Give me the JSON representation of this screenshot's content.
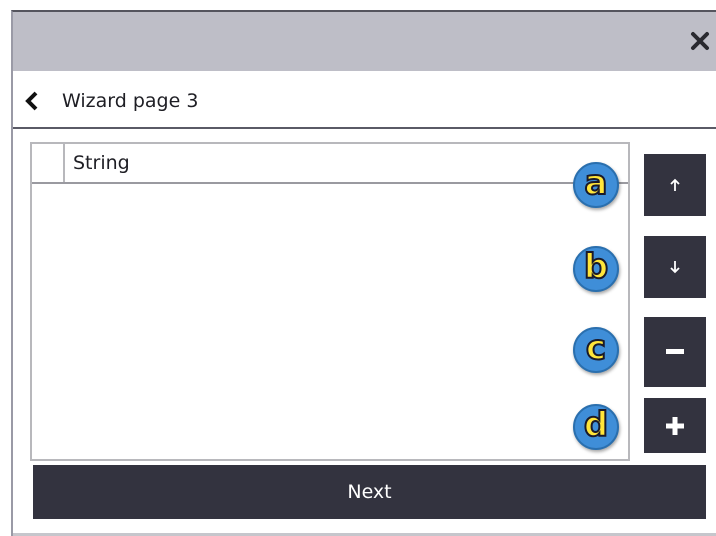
{
  "window": {
    "close_icon": "close-icon"
  },
  "header": {
    "back_icon": "chevron-left-icon",
    "title": "Wizard page 3"
  },
  "grid": {
    "columns": [
      "String"
    ],
    "rows": []
  },
  "side_buttons": [
    {
      "name": "move-up-button",
      "icon": "arrow-up-icon"
    },
    {
      "name": "move-down-button",
      "icon": "arrow-down-icon"
    },
    {
      "name": "remove-button",
      "icon": "minus-icon"
    },
    {
      "name": "add-button",
      "icon": "plus-icon"
    }
  ],
  "annotations": {
    "a": "a",
    "b": "b",
    "c": "c",
    "d": "d"
  },
  "footer": {
    "next_label": "Next"
  },
  "colors": {
    "titlebar": "#bebec7",
    "button_dark": "#33333f",
    "badge_fill": "#3f8ed8",
    "badge_text": "#ffe53a"
  }
}
